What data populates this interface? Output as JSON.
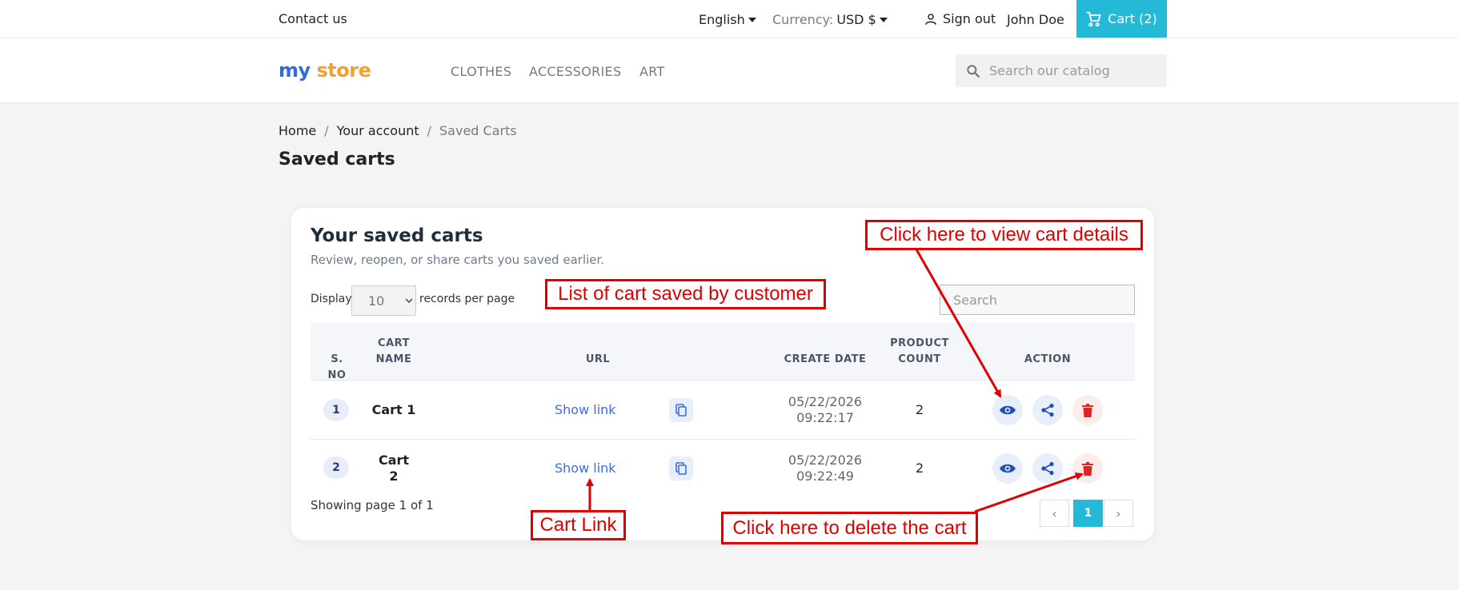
{
  "header": {
    "contact": "Contact us",
    "language": "English",
    "currency_label": "Currency:",
    "currency_value": "USD $",
    "sign_out": "Sign out",
    "user": "John Doe",
    "cart": "Cart (2)"
  },
  "nav": {
    "logo_part1": "my",
    "logo_part2": "store",
    "items": [
      "CLOTHES",
      "ACCESSORIES",
      "ART"
    ],
    "search_placeholder": "Search our catalog"
  },
  "breadcrumb": [
    "Home",
    "/",
    "Your account",
    "/",
    "Saved Carts"
  ],
  "page_title": "Saved carts",
  "card": {
    "title": "Your saved carts",
    "subtitle": "Review, reopen, or share carts you saved earlier.",
    "display_label": "Display",
    "display_value": "10",
    "per_page_label": "records per page",
    "search_placeholder": "Search",
    "columns": {
      "sno": "S. NO",
      "name_1": "CART",
      "name_2": "NAME",
      "url": "URL",
      "date": "CREATE DATE",
      "count_1": "PRODUCT",
      "count_2": "COUNT",
      "action": "ACTION"
    },
    "rows": [
      {
        "sno": "1",
        "name": "Cart 1",
        "url": "Show link",
        "date": "05/22/2026",
        "time": "09:22:17",
        "count": "2"
      },
      {
        "sno": "2",
        "name_1": "Cart",
        "name_2": "2",
        "url": "Show link",
        "date": "05/22/2026",
        "time": "09:22:49",
        "count": "2"
      }
    ],
    "showing": "Showing page 1 of 1",
    "pagination": {
      "prev": "‹",
      "page": "1",
      "next": "›"
    }
  },
  "annotations": {
    "view_details": "Click here to view cart details",
    "list_saved": "List of cart saved by customer",
    "cart_link": "Cart Link",
    "delete_cart": "Click here to delete the cart"
  },
  "colors": {
    "accent": "#24b9d7",
    "link": "#3b6fd6",
    "annotation": "#e00000",
    "danger": "#e02424"
  }
}
